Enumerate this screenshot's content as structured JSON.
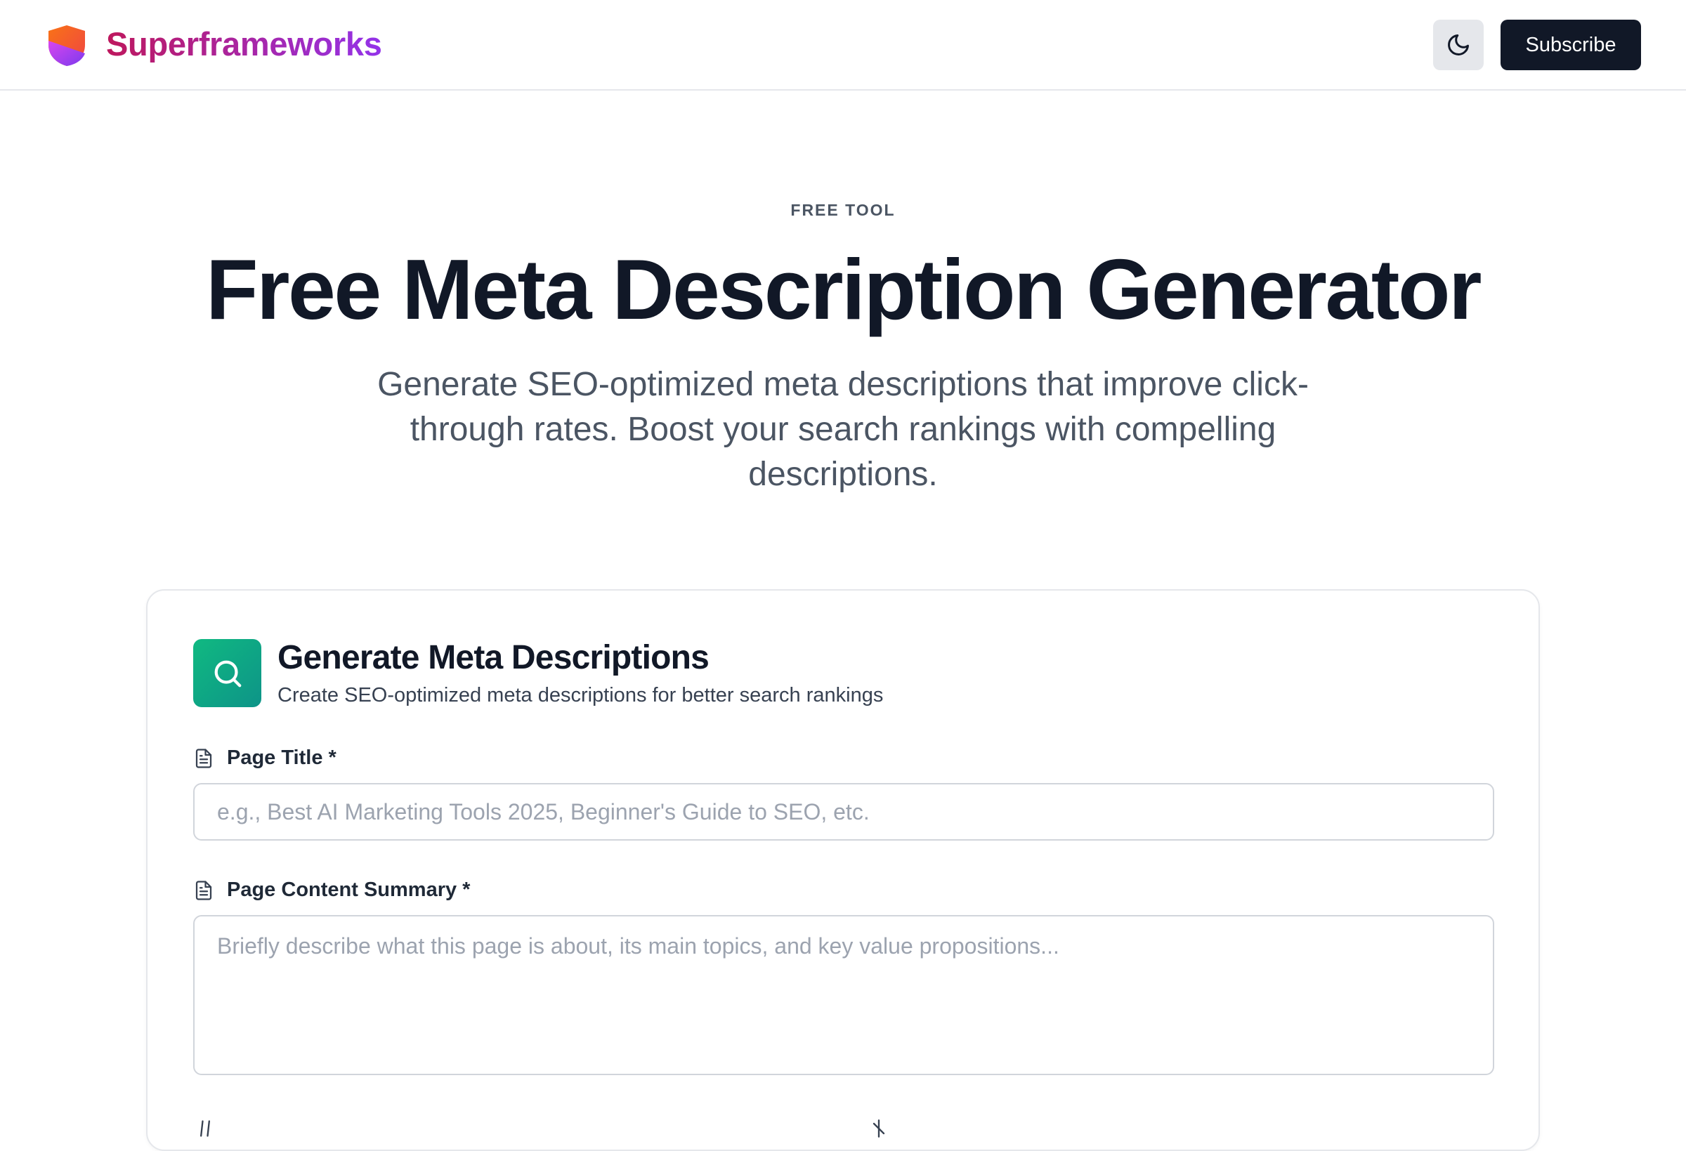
{
  "header": {
    "brand": "Superframeworks",
    "theme_toggle_icon": "moon-icon",
    "subscribe_label": "Subscribe",
    "colors": {
      "brand_start": "#be185d",
      "brand_end": "#9333ea",
      "button_dark": "#111827"
    }
  },
  "hero": {
    "eyebrow": "FREE TOOL",
    "title": "Free Meta Description Generator",
    "subtitle": "Generate SEO-optimized meta descriptions that improve click-through rates. Boost your search rankings with compelling descriptions."
  },
  "card": {
    "icon": "search-icon",
    "title": "Generate Meta Descriptions",
    "subtitle": "Create SEO-optimized meta descriptions for better search rankings",
    "accent": "#10b981",
    "fields": {
      "page_title": {
        "label": "Page Title *",
        "icon": "document-icon",
        "value": "",
        "placeholder": "e.g., Best AI Marketing Tools 2025, Beginner's Guide to SEO, etc."
      },
      "content_summary": {
        "label": "Page Content Summary *",
        "icon": "document-icon",
        "value": "",
        "placeholder": "Briefly describe what this page is about, its main topics, and key value propositions..."
      }
    }
  }
}
